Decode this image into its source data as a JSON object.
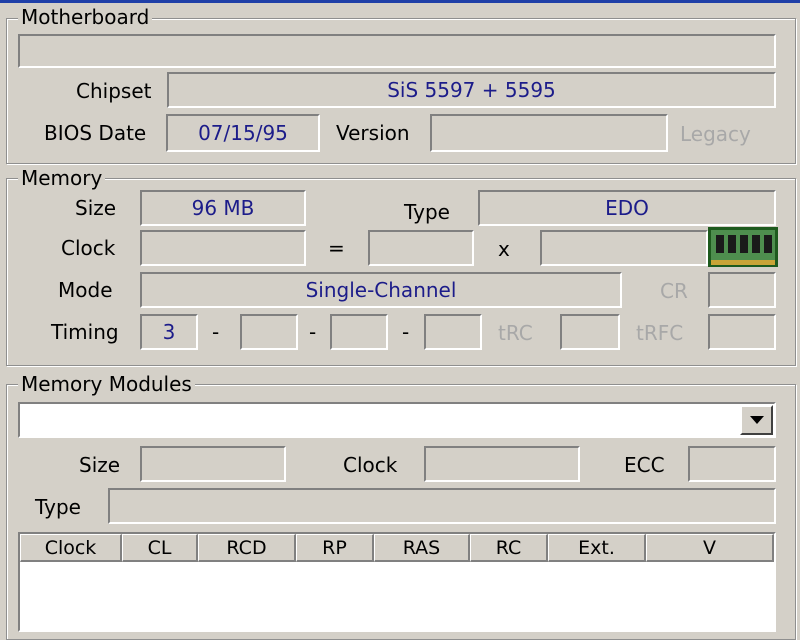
{
  "motherboard": {
    "title": "Motherboard",
    "name_value": "",
    "chipset_label": "Chipset",
    "chipset_value": "SiS 5597 + 5595",
    "bios_date_label": "BIOS Date",
    "bios_date_value": "07/15/95",
    "version_label": "Version",
    "version_value": "",
    "legacy_label": "Legacy"
  },
  "memory": {
    "title": "Memory",
    "size_label": "Size",
    "size_value": "96 MB",
    "type_label": "Type",
    "type_value": "EDO",
    "clock_label": "Clock",
    "clock_value": "",
    "equals": "=",
    "fsb_value": "",
    "times": "x",
    "multiplier_value": "",
    "ram_icon": "ram-module-icon",
    "mode_label": "Mode",
    "mode_value": "Single-Channel",
    "cr_label": "CR",
    "cr_value": "",
    "timing_label": "Timing",
    "timings": [
      "3",
      "",
      "",
      ""
    ],
    "dash": "-",
    "trc_label": "tRC",
    "trc_value": "",
    "trfc_label": "tRFC",
    "trfc_value": ""
  },
  "modules": {
    "title": "Memory Modules",
    "slot_selected": "",
    "dropdown_icon": "chevron-down-icon",
    "size_label": "Size",
    "size_value": "",
    "clock_label": "Clock",
    "clock_value": "",
    "ecc_label": "ECC",
    "ecc_value": "",
    "type_label": "Type",
    "type_value": "",
    "columns": [
      "Clock",
      "CL",
      "RCD",
      "RP",
      "RAS",
      "RC",
      "Ext.",
      "V"
    ]
  },
  "colors": {
    "value_text": "#1c1c8a",
    "face": "#d4d0c8",
    "disabled_text": "#a8a8a8"
  }
}
